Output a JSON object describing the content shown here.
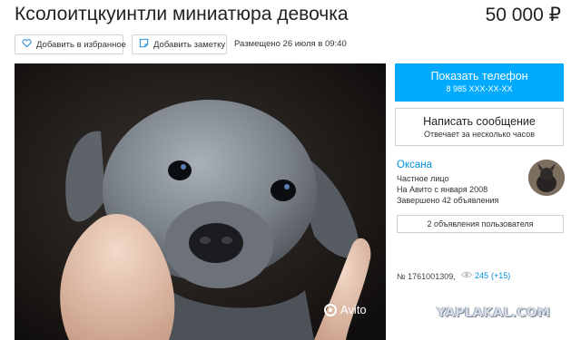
{
  "header": {
    "title": "Ксолоитцкуинтли миниатюра девочка",
    "price": "50 000 ₽"
  },
  "actions": {
    "favorite_label": "Добавить в избранное",
    "note_label": "Добавить заметку",
    "placed_text": "Размещено 26 июля в 09:40"
  },
  "photo": {
    "watermark": "Avito"
  },
  "sidebar": {
    "phone_button": {
      "label": "Показать телефон",
      "number": "8 985 XXX-XX-XX"
    },
    "message_button": {
      "label": "Написать сообщение",
      "sub": "Отвечает за несколько часов"
    },
    "seller": {
      "name": "Оксана",
      "type": "Частное лицо",
      "since": "На Авито с января 2008",
      "completed": "Завершено 42 объявления"
    },
    "user_ads_button": "2 объявления пользователя",
    "ad_number": "№ 1761001309,",
    "views": "245",
    "views_new": "(+15)"
  },
  "overlay": {
    "site_watermark": "YAPLAKAL.COM"
  },
  "colors": {
    "accent": "#00aaff",
    "link": "#0091d9"
  }
}
